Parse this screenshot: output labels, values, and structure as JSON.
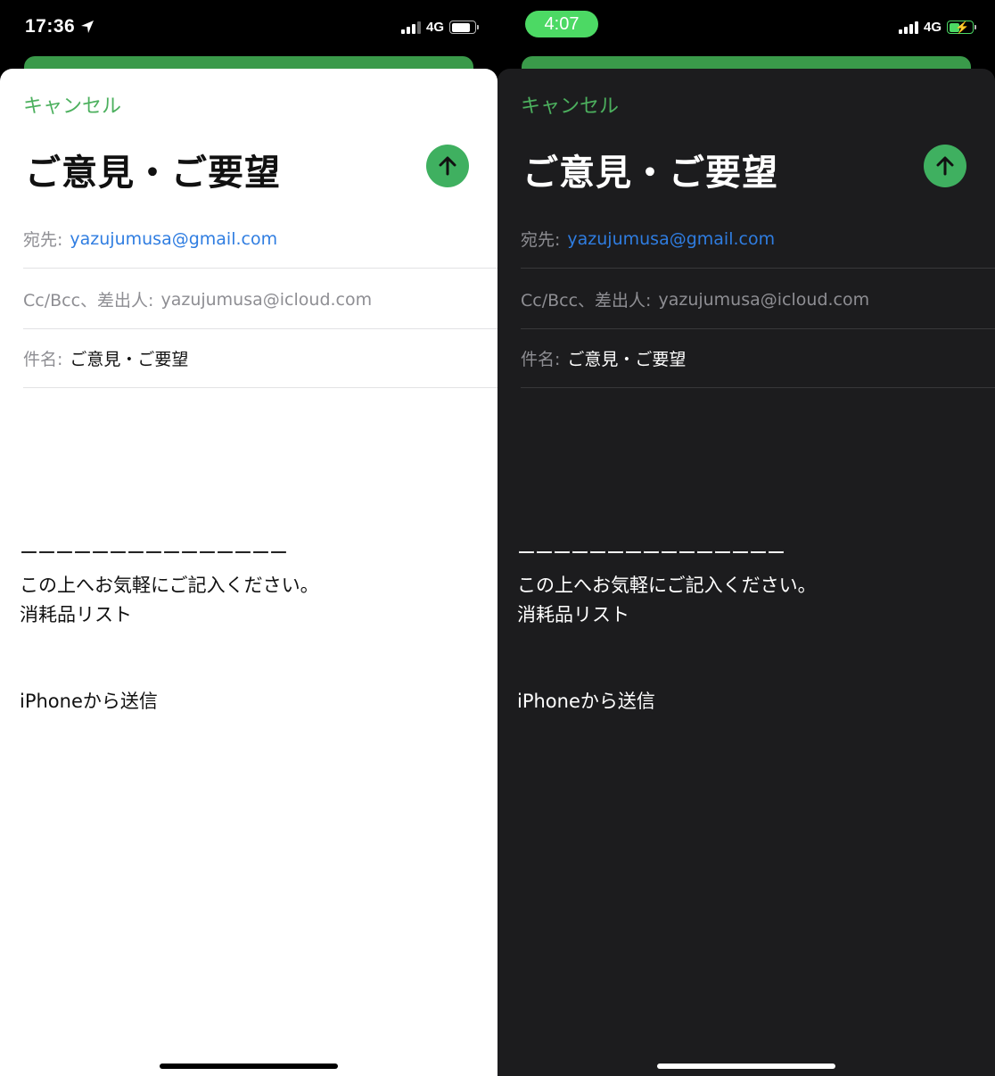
{
  "light": {
    "status": {
      "time": "17:36",
      "network": "4G"
    },
    "compose": {
      "cancel_label": "キャンセル",
      "title": "ご意見・ご要望",
      "to_label": "宛先:",
      "to_value": "yazujumusa@gmail.com",
      "cc_label": "Cc/Bcc、差出人:",
      "cc_value": "yazujumusa@icloud.com",
      "subject_label": "件名:",
      "subject_value": "ご意見・ご要望",
      "body_separator": "ーーーーーーーーーーーーーーー",
      "body_prompt": "この上へお気軽にご記入ください。",
      "body_list": "消耗品リスト",
      "signature": "iPhoneから送信"
    }
  },
  "dark": {
    "status": {
      "time": "4:07",
      "network": "4G"
    },
    "compose": {
      "cancel_label": "キャンセル",
      "title": "ご意見・ご要望",
      "to_label": "宛先:",
      "to_value": "yazujumusa@gmail.com",
      "cc_label": "Cc/Bcc、差出人:",
      "cc_value": "yazujumusa@icloud.com",
      "subject_label": "件名:",
      "subject_value": "ご意見・ご要望",
      "body_separator": "ーーーーーーーーーーーーーーー",
      "body_prompt": "この上へお気軽にご記入ください。",
      "body_list": "消耗品リスト",
      "signature": "iPhoneから送信"
    }
  },
  "colors": {
    "accent_green": "#3fb060",
    "link_blue": "#2f7de1",
    "dark_background": "#1c1c1e"
  },
  "icons": [
    "location-arrow-icon",
    "signal-icon",
    "battery-icon",
    "battery-charging-icon",
    "arrow-up-icon"
  ]
}
